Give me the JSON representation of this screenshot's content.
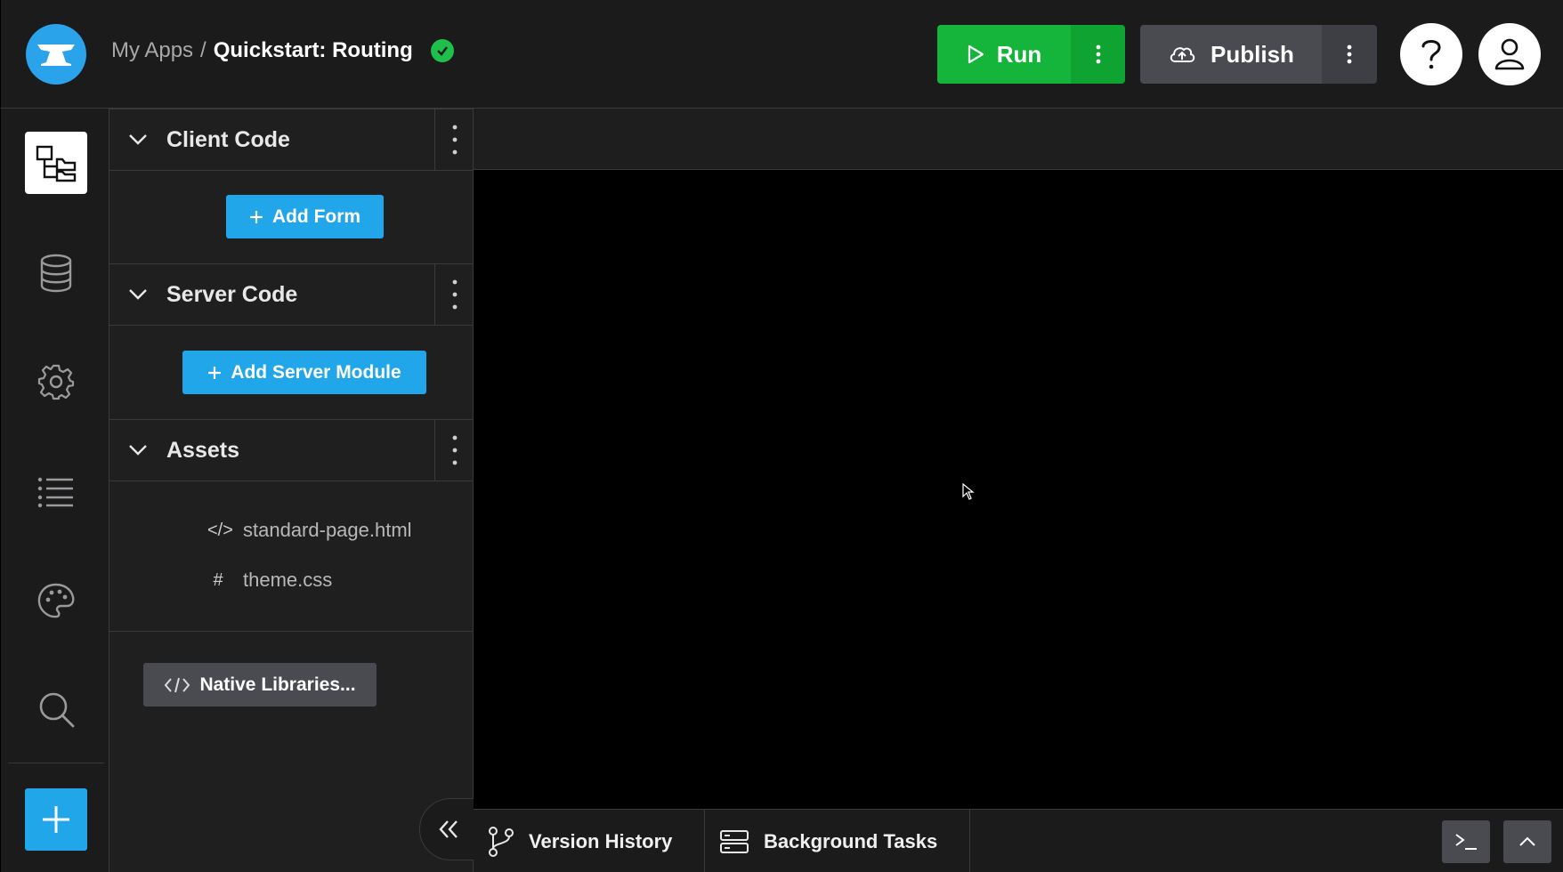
{
  "header": {
    "breadcrumb_root": "My Apps",
    "separator": "/",
    "app_title": "Quickstart: Routing",
    "status": "saved",
    "run_label": "Run",
    "publish_label": "Publish"
  },
  "rail": {
    "items": [
      "app-browser-icon",
      "database-icon",
      "gear-icon",
      "list-icon",
      "palette-icon",
      "search-icon"
    ],
    "add_icon": "plus-icon"
  },
  "panel": {
    "client_code": {
      "title": "Client Code",
      "button": "Add Form"
    },
    "server_code": {
      "title": "Server Code",
      "button": "Add Server Module"
    },
    "assets": {
      "title": "Assets",
      "items": [
        {
          "icon": "</>",
          "name": "standard-page.html"
        },
        {
          "icon": "#",
          "name": "theme.css"
        }
      ]
    },
    "native_libraries": "Native Libraries..."
  },
  "bottom": {
    "version_history": "Version History",
    "background_tasks": "Background Tasks"
  },
  "colors": {
    "run_green": "#14b53a",
    "accent_blue": "#22a6ea",
    "bg_dark": "#1b1b1c",
    "canvas": "#000000"
  }
}
